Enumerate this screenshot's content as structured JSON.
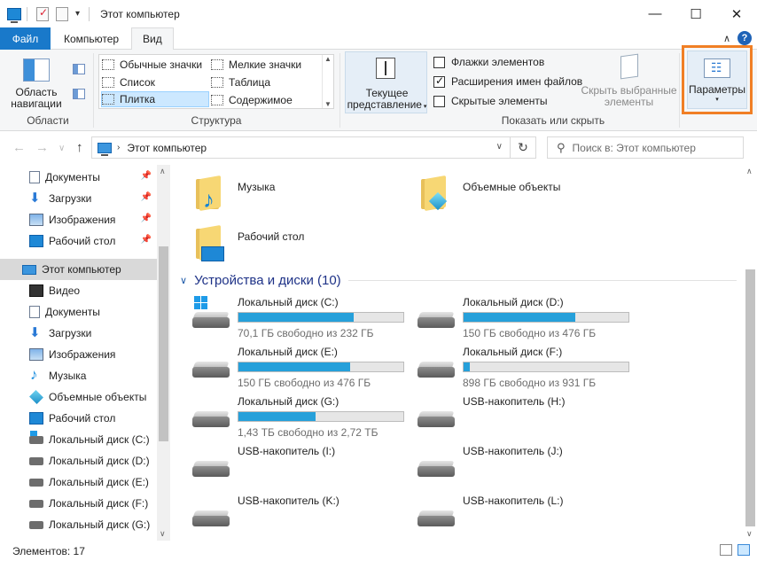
{
  "window": {
    "title": "Этот компьютер",
    "minimize": "—",
    "maximize": "☐",
    "close": "✕",
    "qa_dropdown": "▾"
  },
  "ribbon_tabs": {
    "file": "Файл",
    "computer": "Компьютер",
    "view": "Вид",
    "collapse": "∧",
    "help": "?"
  },
  "ribbon": {
    "panes": {
      "nav_pane_label_1": "Область",
      "nav_pane_label_2": "навигации",
      "group_label": "Области"
    },
    "layout": {
      "items": [
        "Обычные значки",
        "Мелкие значки",
        "Список",
        "Таблица",
        "Плитка",
        "Содержимое"
      ],
      "selected": "Плитка",
      "group_label": "Структура"
    },
    "current_view": {
      "label_1": "Текущее",
      "label_2": "представление"
    },
    "show_hide": {
      "item_checkboxes": "Флажки элементов",
      "file_extensions": "Расширения имен файлов",
      "hidden_items": "Скрытые элементы",
      "hide_selected_1": "Скрыть выбранные",
      "hide_selected_2": "элементы",
      "group_label": "Показать или скрыть",
      "checked": {
        "item_checkboxes": false,
        "file_extensions": true,
        "hidden_items": false
      }
    },
    "options": {
      "label": "Параметры",
      "arrow": "▾",
      "highlight_color": "#f07f25"
    }
  },
  "address_bar": {
    "path": "Этот компьютер",
    "search_placeholder": "Поиск в: Этот компьютер",
    "back": "←",
    "forward": "→",
    "dropdown": "∨",
    "up": "↑",
    "refresh": "↻",
    "chevron": "›",
    "addr_drop": "∨",
    "search_icon": "⚲"
  },
  "nav_pane": {
    "quick_access": [
      {
        "label": "Документы",
        "icon": "document-icon"
      },
      {
        "label": "Загрузки",
        "icon": "download-icon"
      },
      {
        "label": "Изображения",
        "icon": "pictures-icon"
      },
      {
        "label": "Рабочий стол",
        "icon": "desktop-icon"
      }
    ],
    "this_pc": "Этот компьютер",
    "pc_items": [
      {
        "label": "Видео",
        "icon": "video-icon"
      },
      {
        "label": "Документы",
        "icon": "document-icon"
      },
      {
        "label": "Загрузки",
        "icon": "download-icon"
      },
      {
        "label": "Изображения",
        "icon": "pictures-icon"
      },
      {
        "label": "Музыка",
        "icon": "music-icon"
      },
      {
        "label": "Объемные объекты",
        "icon": "3d-objects-icon"
      },
      {
        "label": "Рабочий стол",
        "icon": "desktop-icon"
      },
      {
        "label": "Локальный диск (C:)",
        "icon": "system-drive-icon"
      },
      {
        "label": "Локальный диск (D:)",
        "icon": "drive-icon"
      },
      {
        "label": "Локальный диск (E:)",
        "icon": "drive-icon"
      },
      {
        "label": "Локальный диск (F:)",
        "icon": "drive-icon"
      },
      {
        "label": "Локальный диск (G:)",
        "icon": "drive-icon"
      }
    ],
    "pin": "📌",
    "scroll_up": "∧",
    "scroll_down": "∨"
  },
  "main": {
    "folders": [
      {
        "name": "Музыка",
        "icon": "music-folder-icon"
      },
      {
        "name": "Объемные объекты",
        "icon": "3d-objects-folder-icon"
      },
      {
        "name": "Рабочий стол",
        "icon": "desktop-folder-icon"
      }
    ],
    "devices_header": "Устройства и диски (10)",
    "group_chevron": "∨",
    "drives": [
      {
        "name": "Локальный диск (C:)",
        "free": "70,1 ГБ свободно из 232 ГБ",
        "used_fraction": 0.7,
        "system": true
      },
      {
        "name": "Локальный диск (D:)",
        "free": "150 ГБ свободно из 476 ГБ",
        "used_fraction": 0.68
      },
      {
        "name": "Локальный диск (E:)",
        "free": "150 ГБ свободно из 476 ГБ",
        "used_fraction": 0.68
      },
      {
        "name": "Локальный диск (F:)",
        "free": "898 ГБ свободно из 931 ГБ",
        "used_fraction": 0.04
      },
      {
        "name": "Локальный диск (G:)",
        "free": "1,43 ТБ свободно из 2,72 ТБ",
        "used_fraction": 0.47
      },
      {
        "name": "USB-накопитель (H:)"
      },
      {
        "name": "USB-накопитель (I:)"
      },
      {
        "name": "USB-накопитель (J:)"
      },
      {
        "name": "USB-накопитель (K:)"
      },
      {
        "name": "USB-накопитель (L:)"
      }
    ]
  },
  "status_bar": {
    "items": "Элементов: 17"
  },
  "colors": {
    "accent": "#1979ca",
    "bar_fill": "#26a0da",
    "selection": "#cce8ff"
  }
}
